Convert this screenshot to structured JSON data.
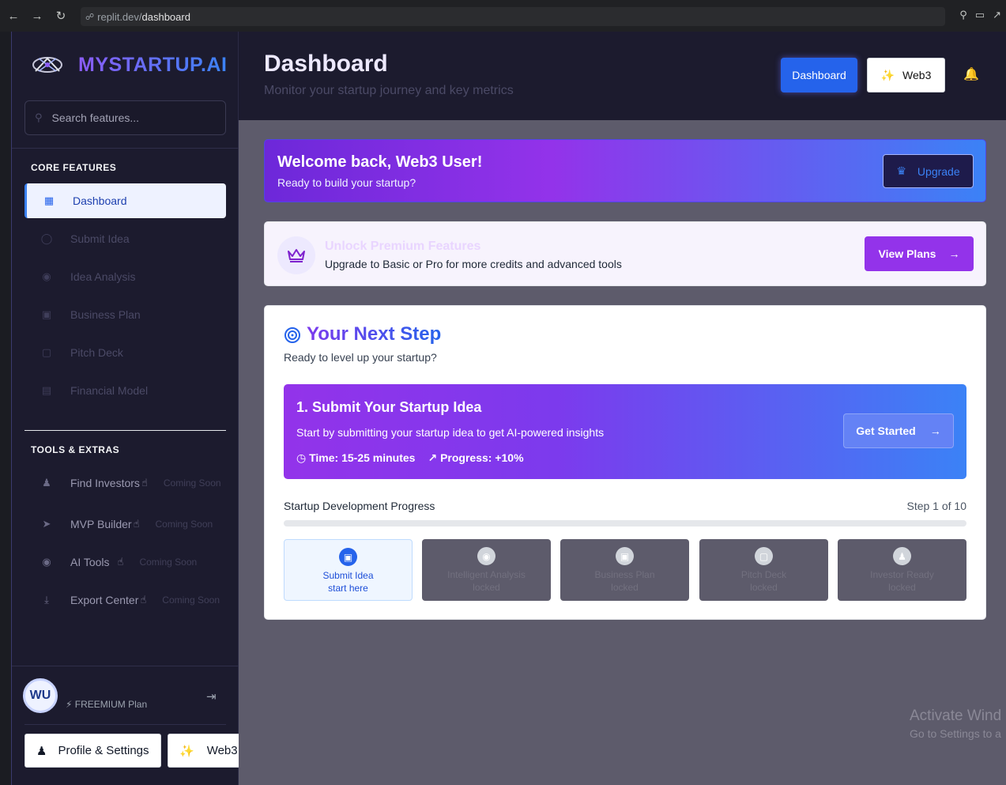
{
  "browser": {
    "url_prefix": "replit.dev/",
    "url_path": "dashboard"
  },
  "sidebar": {
    "brand": "MYSTARTUP.AI",
    "search_placeholder": "Search features...",
    "core_title": "CORE FEATURES",
    "core_items": [
      {
        "label": "Dashboard",
        "icon": "grid-icon",
        "active": true
      },
      {
        "label": "Submit Idea",
        "icon": "lightbulb-icon"
      },
      {
        "label": "Idea Analysis",
        "icon": "brain-icon"
      },
      {
        "label": "Business Plan",
        "icon": "document-icon"
      },
      {
        "label": "Pitch Deck",
        "icon": "presentation-icon"
      },
      {
        "label": "Financial Model",
        "icon": "calculator-icon"
      }
    ],
    "tools_title": "TOOLS & EXTRAS",
    "tools_items": [
      {
        "label": "Find Investors",
        "badge": "Coming Soon",
        "icon": "users-icon"
      },
      {
        "label": "MVP Builder",
        "badge": "Coming Soon",
        "icon": "rocket-icon"
      },
      {
        "label": "AI Tools",
        "badge": "Coming Soon",
        "icon": "brain-icon"
      },
      {
        "label": "Export Center",
        "badge": "Coming Soon",
        "icon": "download-icon"
      }
    ],
    "user_initials": "WU",
    "plan": "FREEMIUM Plan",
    "profile_button": "Profile & Settings",
    "web3_button": "Web3"
  },
  "header": {
    "title": "Dashboard",
    "subtitle": "Monitor your startup journey and key metrics",
    "dashboard_button": "Dashboard",
    "web3_button": "Web3"
  },
  "welcome": {
    "title": "Welcome back, Web3 User!",
    "subtitle": "Ready to build your startup?",
    "upgrade_button": "Upgrade"
  },
  "premium": {
    "title": "Unlock Premium Features",
    "subtitle": "Upgrade to Basic or Pro for more credits and advanced tools",
    "button": "View Plans"
  },
  "next_step": {
    "title": "Your Next Step",
    "subtitle": "Ready to level up your startup?",
    "step_title": "1. Submit Your Startup Idea",
    "step_desc": "Start by submitting your startup idea to get AI-powered insights",
    "time": "Time: 15-25 minutes",
    "progress_gain": "Progress: +10%",
    "start_button": "Get Started",
    "progress_label": "Startup Development Progress",
    "progress_step": "Step 1 of 10",
    "progress_fraction": 0,
    "tiles": [
      {
        "name": "Submit Idea",
        "state": "start here",
        "icon": "document-icon"
      },
      {
        "name": "Intelligent Analysis",
        "state": "locked",
        "icon": "brain-icon"
      },
      {
        "name": "Business Plan",
        "state": "locked",
        "icon": "document-icon"
      },
      {
        "name": "Pitch Deck",
        "state": "locked",
        "icon": "presentation-icon"
      },
      {
        "name": "Investor Ready",
        "state": "locked",
        "icon": "users-icon"
      }
    ]
  },
  "watermark": {
    "line1": "Activate Wind",
    "line2": "Go to Settings to a"
  }
}
